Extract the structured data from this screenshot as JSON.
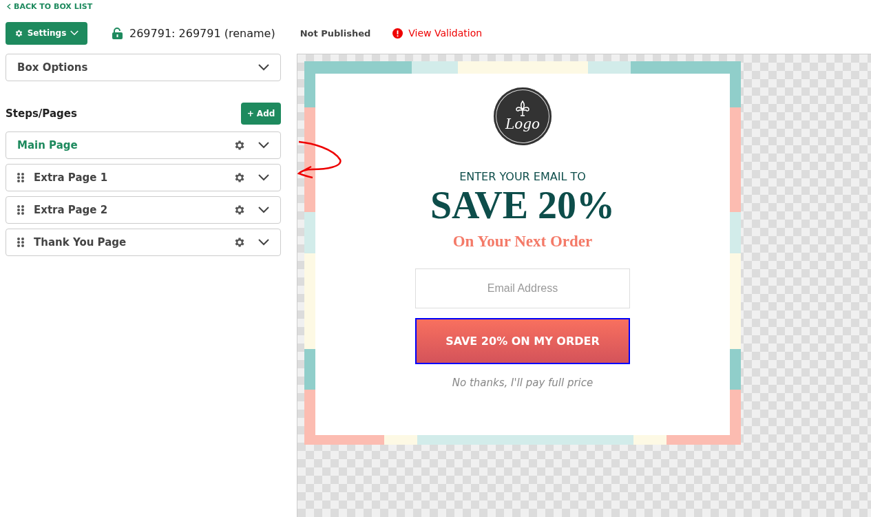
{
  "back_link": "BACK TO BOX LIST",
  "toolbar": {
    "settings_button": "Settings",
    "box_name": "269791: 269791 (rename)",
    "status": "Not Published",
    "validation_link": "View Validation"
  },
  "box_options": {
    "label": "Box Options",
    "expanded": false
  },
  "steps": {
    "title": "Steps/Pages",
    "add_button": "+ Add",
    "items": [
      {
        "label": "Main Page",
        "selected": true,
        "draggable": false
      },
      {
        "label": "Extra Page 1",
        "selected": false,
        "draggable": true
      },
      {
        "label": "Extra Page 2",
        "selected": false,
        "draggable": true
      },
      {
        "label": "Thank You Page",
        "selected": false,
        "draggable": true
      }
    ]
  },
  "popup": {
    "logo_text": "Logo",
    "kicker": "ENTER YOUR EMAIL TO",
    "headline": "SAVE 20%",
    "subheadline": "On Your Next Order",
    "email_field": {
      "placeholder": "Email Address"
    },
    "submit_button": {
      "label": "SAVE 20% ON MY ORDER",
      "selected": true
    },
    "decline_link": "No thanks, I'll pay full price"
  }
}
